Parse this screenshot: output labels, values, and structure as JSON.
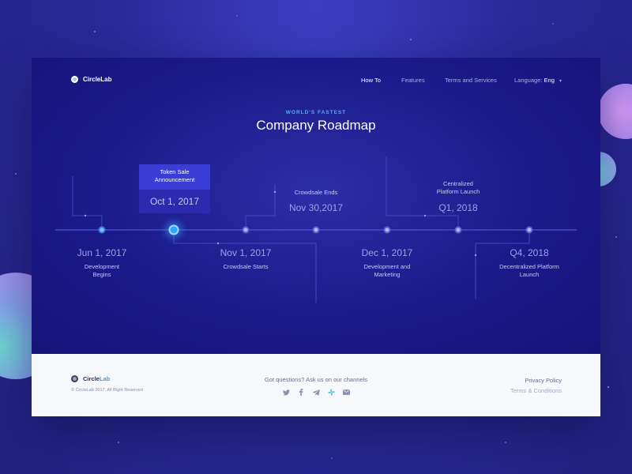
{
  "brand": {
    "name": "CircleLab"
  },
  "nav": {
    "items": [
      "How To",
      "Features",
      "Terms and Services"
    ],
    "language_label": "Language:",
    "language_value": "Eng"
  },
  "hero": {
    "eyebrow": "WORLD'S FASTEST",
    "title": "Company Roadmap"
  },
  "timeline": {
    "milestones": [
      {
        "date": "Jun 1, 2017",
        "label_line1": "Development",
        "label_line2": "Begins"
      },
      {
        "date": "Oct 1, 2017",
        "label_line1": "Token Sale",
        "label_line2": "Announcement"
      },
      {
        "date": "Nov 1, 2017",
        "label_line1": "Crowdsale Starts",
        "label_line2": ""
      },
      {
        "date": "Nov 30,2017",
        "label_line1": "Crowdsale Ends",
        "label_line2": ""
      },
      {
        "date": "Dec 1, 2017",
        "label_line1": "Development and",
        "label_line2": "Marketing"
      },
      {
        "date": "Q1, 2018",
        "label_line1": "Centralized",
        "label_line2": "Platform Launch"
      },
      {
        "date": "Q4, 2018",
        "label_line1": "Decentralized Platform",
        "label_line2": "Launch"
      }
    ],
    "active_index": 1
  },
  "footer": {
    "brand_part1": "Circle",
    "brand_part2": "Lab",
    "copyright": "© CircleLab 2017. All Right Reserved",
    "questions": "Got questions? Ask us on our channels",
    "socials": [
      "twitter-icon",
      "facebook-icon",
      "telegram-icon",
      "slack-icon",
      "mail-icon"
    ],
    "privacy": "Privacy Policy",
    "terms": "Terms & Conditions"
  },
  "colors": {
    "accent": "#2aa6ff",
    "eyebrow": "#4db0f0",
    "hero_bg": "#1c1a8a",
    "highlight_top": "#3a3dd6",
    "highlight_bottom": "#2a2bae"
  }
}
